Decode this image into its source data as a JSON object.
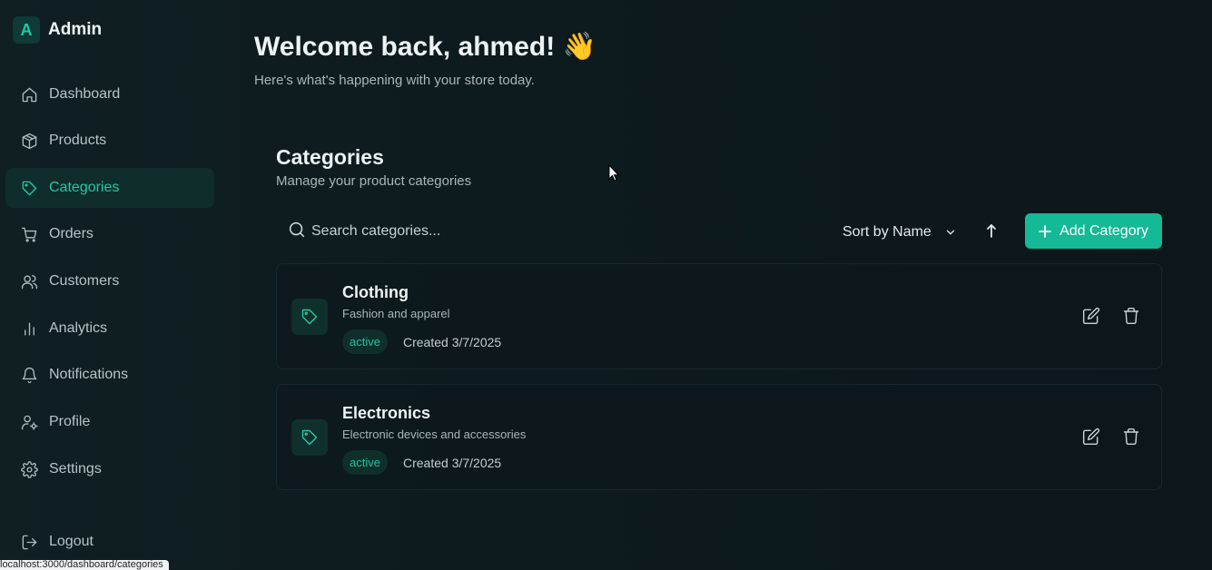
{
  "brand": {
    "logo_letter": "A",
    "name": "Admin"
  },
  "sidebar": {
    "items": [
      {
        "label": "Dashboard",
        "icon": "home-icon"
      },
      {
        "label": "Products",
        "icon": "box-icon"
      },
      {
        "label": "Categories",
        "icon": "tag-icon",
        "active": true
      },
      {
        "label": "Orders",
        "icon": "cart-icon"
      },
      {
        "label": "Customers",
        "icon": "users-icon"
      },
      {
        "label": "Analytics",
        "icon": "bar-chart-icon"
      },
      {
        "label": "Notifications",
        "icon": "bell-icon"
      },
      {
        "label": "Profile",
        "icon": "user-cog-icon"
      },
      {
        "label": "Settings",
        "icon": "gear-icon"
      }
    ],
    "logout_label": "Logout"
  },
  "status_url": "localhost:3000/dashboard/categories",
  "header": {
    "welcome": "Welcome back, ahmed! 👋",
    "subtitle": "Here's what's happening with your store today."
  },
  "categories_section": {
    "title": "Categories",
    "subtitle": "Manage your product categories",
    "search_placeholder": "Search categories...",
    "sort_label": "Sort by Name",
    "sort_direction": "ascending",
    "add_label": "Add Category"
  },
  "categories": [
    {
      "name": "Clothing",
      "description": "Fashion and apparel",
      "status": "active",
      "created": "Created 3/7/2025"
    },
    {
      "name": "Electronics",
      "description": "Electronic devices and accessories",
      "status": "active",
      "created": "Created 3/7/2025"
    }
  ],
  "colors": {
    "accent": "#14b996",
    "background": "#0d181c",
    "active_bg": "#0f2e2b"
  }
}
